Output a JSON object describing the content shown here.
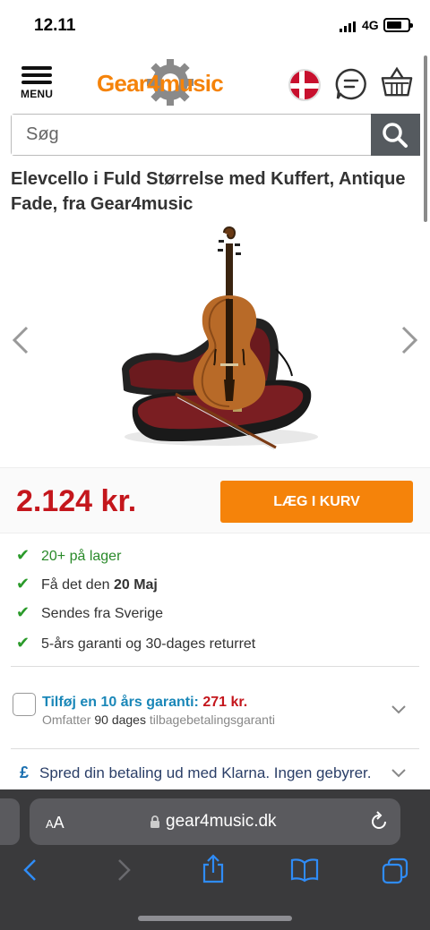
{
  "status_bar": {
    "time": "12.11",
    "network": "4G"
  },
  "header": {
    "menu_label": "MENU",
    "logo_text": "Gear4music",
    "icons": [
      "danish-flag-icon",
      "chat-icon",
      "basket-icon"
    ]
  },
  "search": {
    "placeholder": "Søg",
    "value": ""
  },
  "product": {
    "title": "Elevcello i Fuld Størrelse med Kuffert, Antique Fade, fra Gear4music",
    "price": "2.124 kr.",
    "add_to_cart_label": "LÆG I KURV"
  },
  "features": {
    "stock": "20+ på lager",
    "delivery_prefix": "Få det den ",
    "delivery_date": "20 Maj",
    "ships_from": "Sendes fra Sverige",
    "guarantee": "5-års garanti og 30-dages returret"
  },
  "warranty": {
    "label": "Tilføj en 10 års garanti:",
    "price": "271 kr.",
    "sub_prefix": "Omfatter ",
    "sub_days": "90 dages",
    "sub_suffix": " tilbagebetalingsgaranti"
  },
  "klarna": {
    "icon_text": "£",
    "text": "Spred din betaling ud med Klarna. Ingen gebyrer."
  },
  "browser": {
    "aa_label": "AA",
    "url": "gear4music.dk"
  },
  "colors": {
    "brand_orange": "#f5830a",
    "price_red": "#c4161c",
    "check_green": "#2a9a2a",
    "link_blue": "#1a87b8"
  }
}
